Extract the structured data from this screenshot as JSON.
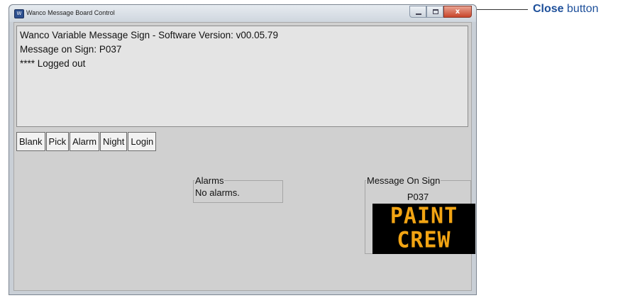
{
  "window": {
    "title": "Wanco Message Board Control",
    "app_icon": "W",
    "buttons": {
      "minimize": "minimize-icon",
      "maximize": "maximize-icon",
      "close": "close-icon",
      "close_glyph": "x"
    }
  },
  "log": {
    "lines": [
      "Wanco Variable Message Sign - Software Version: v00.05.79",
      "Message on Sign: P037",
      "**** Logged out"
    ]
  },
  "toolbar": {
    "buttons": [
      "Blank",
      "Pick",
      "Alarm",
      "Night",
      "Login"
    ]
  },
  "alarms": {
    "title": "Alarms",
    "status": "No alarms."
  },
  "sign": {
    "title": "Message On Sign",
    "code": "P037",
    "lines": [
      "PAINT",
      "CREW"
    ],
    "text_color": "#f2a413",
    "background": "#000000"
  },
  "callout": {
    "bold": "Close",
    "rest": " button"
  }
}
